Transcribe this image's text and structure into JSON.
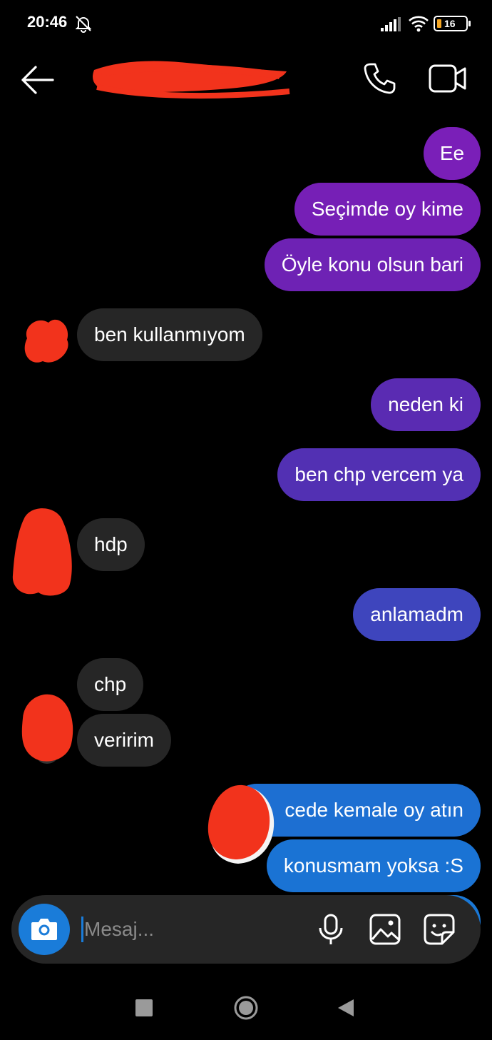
{
  "status_bar": {
    "time": "20:46",
    "battery_level": "16",
    "icons": [
      "bell-off-icon",
      "signal-icon",
      "wifi-icon",
      "battery-icon"
    ]
  },
  "header": {
    "icons": [
      "arrow-left-icon",
      "phone-icon",
      "video-camera-icon"
    ]
  },
  "colors": {
    "background": "#000000",
    "incoming_bubble": "#262626",
    "accent_blue": "#1a7cd9"
  },
  "messages": [
    {
      "sender": "me",
      "text": "Ee",
      "color": "#7a1fb8"
    },
    {
      "sender": "me",
      "text": "Seçimde oy kime",
      "color": "#761fb6"
    },
    {
      "sender": "me",
      "text": "Öyle konu olsun bari",
      "color": "#6e22b4"
    },
    {
      "sender": "them",
      "text": "ben kullanmıyom"
    },
    {
      "sender": "me",
      "text": "neden ki",
      "color": "#5a2bb2"
    },
    {
      "sender": "me",
      "text": "ben chp vercem ya",
      "color": "#5230b3"
    },
    {
      "sender": "them",
      "text": "hdp"
    },
    {
      "sender": "me",
      "text": "anlamadm",
      "color": "#3e45bd"
    },
    {
      "sender": "them",
      "text": "chp"
    },
    {
      "sender": "them",
      "text": "veririm"
    },
    {
      "sender": "me",
      "text": "cede kemale oy atın",
      "color": "#1d6fd2"
    },
    {
      "sender": "me",
      "text": "konusmam yoksa :S",
      "color": "#1a73d4"
    }
  ],
  "composer": {
    "placeholder": "Mesaj...",
    "icons": [
      "camera-icon",
      "microphone-icon",
      "image-icon",
      "sticker-icon"
    ]
  },
  "nav_bar": {
    "icons": [
      "recent-apps-icon",
      "home-icon",
      "back-icon"
    ]
  }
}
